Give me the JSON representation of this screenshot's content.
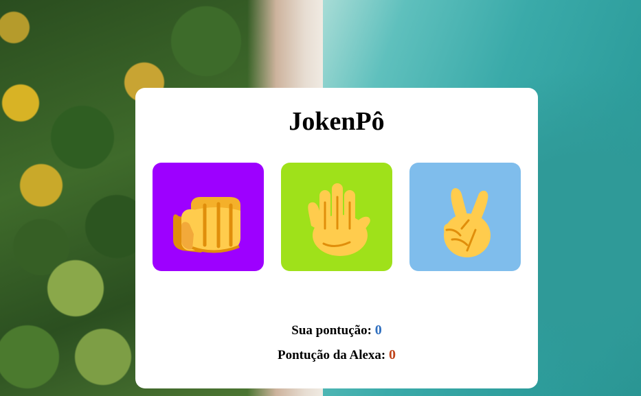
{
  "app": {
    "title": "JokenPô"
  },
  "choices": [
    {
      "name": "rock",
      "icon": "fist-icon",
      "color": "#9d00ff"
    },
    {
      "name": "paper",
      "icon": "open-hand-icon",
      "color": "#9fe11a"
    },
    {
      "name": "scissors",
      "icon": "victory-hand-icon",
      "color": "#7fbdec"
    }
  ],
  "score": {
    "user_label": "Sua pontução:",
    "user_value": "0",
    "user_color": "#2f6fbf",
    "cpu_label": "Pontução da Alexa:",
    "cpu_value": "0",
    "cpu_color": "#c0441a"
  }
}
